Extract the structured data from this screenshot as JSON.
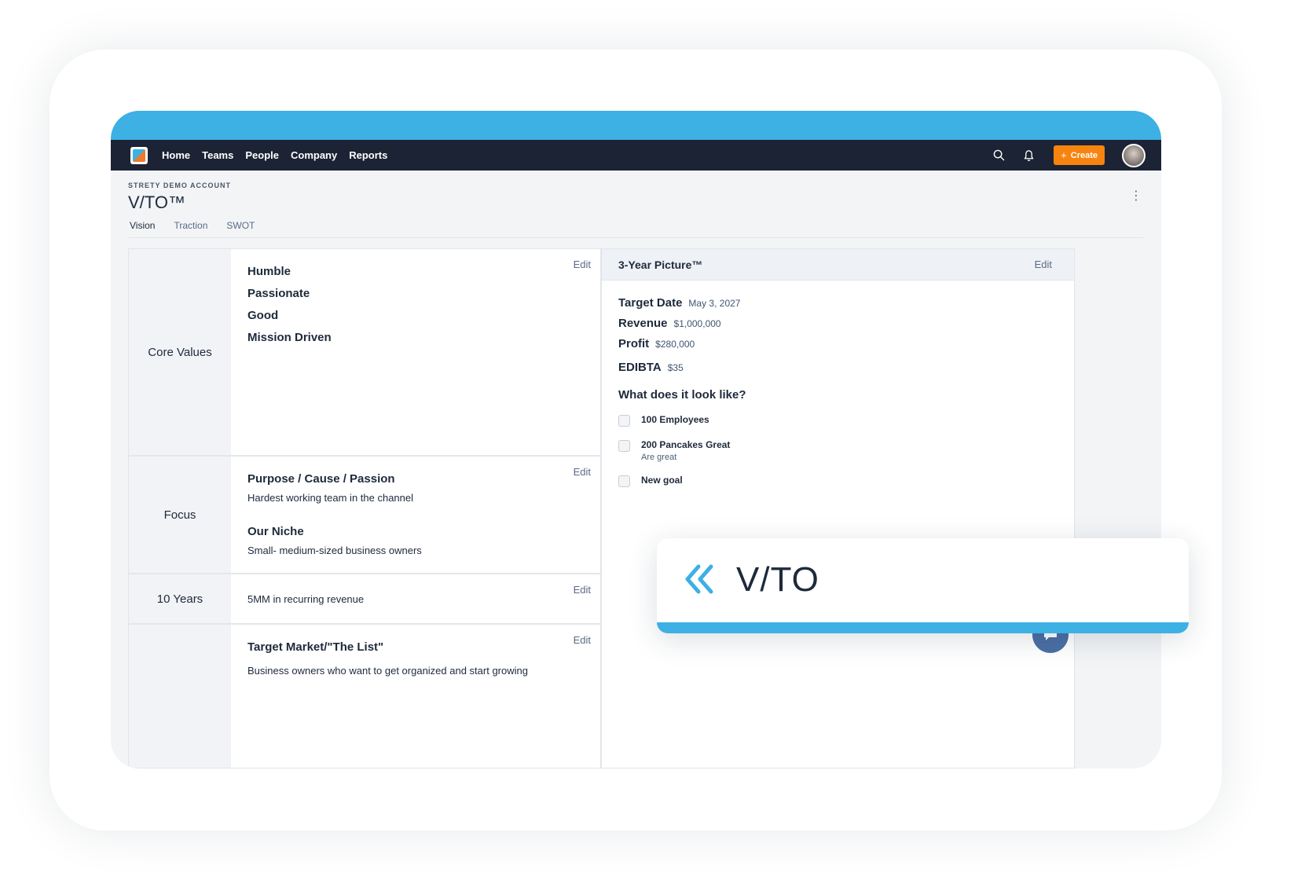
{
  "nav": {
    "links": [
      "Home",
      "Teams",
      "People",
      "Company",
      "Reports"
    ],
    "create_label": "Create"
  },
  "header": {
    "account": "STRETY DEMO ACCOUNT",
    "title": "V/TO™",
    "tabs": [
      "Vision",
      "Traction",
      "SWOT"
    ]
  },
  "edit_label": "Edit",
  "core_values": {
    "label": "Core Values",
    "items": [
      "Humble",
      "Passionate",
      "Good",
      "Mission Driven"
    ]
  },
  "focus": {
    "label": "Focus",
    "purpose_heading": "Purpose / Cause / Passion",
    "purpose_text": "Hardest working team in the channel",
    "niche_heading": "Our Niche",
    "niche_text": "Small- medium-sized business owners"
  },
  "ten_years": {
    "label": "10 Years",
    "text": "5MM in recurring revenue"
  },
  "marketing": {
    "heading": "Target Market/\"The List\"",
    "text": "Business owners who want to get organized and start growing"
  },
  "three_year": {
    "title": "3-Year Picture™",
    "metrics": [
      {
        "label": "Target Date",
        "value": "May 3, 2027"
      },
      {
        "label": "Revenue",
        "value": "$1,000,000"
      },
      {
        "label": "Profit",
        "value": "$280,000"
      },
      {
        "label": "EDIBTA",
        "value": "$35"
      }
    ],
    "question": "What does it look like?",
    "goals": [
      {
        "title": "100 Employees",
        "sub": ""
      },
      {
        "title": "200 Pancakes Great",
        "sub": "Are great"
      },
      {
        "title": "New goal",
        "sub": ""
      }
    ]
  },
  "overlay": {
    "title": "V/TO"
  },
  "colors": {
    "accent": "#3db0e4",
    "navbar": "#1b2334",
    "create_button": "#f7840f"
  }
}
